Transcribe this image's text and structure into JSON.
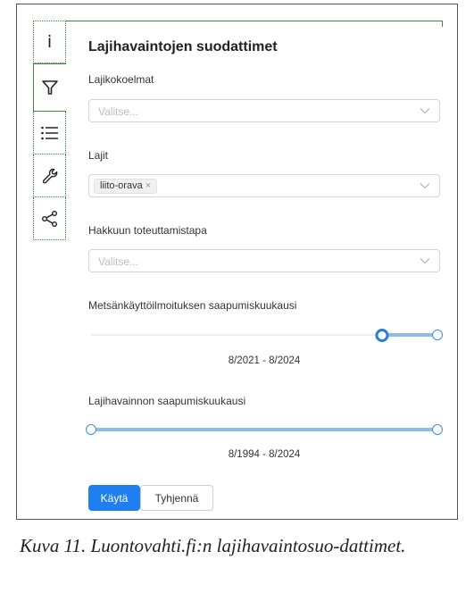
{
  "toolbar": {
    "items": [
      {
        "icon": "info-icon",
        "glyph": "i"
      },
      {
        "icon": "filter-icon",
        "active": true
      },
      {
        "icon": "list-icon"
      },
      {
        "icon": "wrench-icon"
      },
      {
        "icon": "share-icon"
      }
    ],
    "accent_color": "#3a8a3a"
  },
  "panel": {
    "title": "Lajihavaintojen suodattimet",
    "filters": {
      "species_collections": {
        "label": "Lajikokoelmat",
        "placeholder": "Valitse..."
      },
      "species": {
        "label": "Lajit",
        "selected_tags": [
          "liito-orava"
        ],
        "tag_remove": "×"
      },
      "harvest_method": {
        "label": "Hakkuun toteuttamistapa",
        "placeholder": "Valitse..."
      }
    },
    "forest_notice_month": {
      "label": "Metsänkäyttöilmoituksen saapumiskuukausi",
      "range_text": "8/2021 - 8/2024",
      "handle_start": 0.84,
      "handle_end": 1.0
    },
    "observation_month": {
      "label": "Lajihavainnon saapumiskuukausi",
      "range_text": "8/1994 - 8/2024",
      "handle_start": 0.0,
      "handle_end": 1.0
    },
    "buttons": {
      "apply": "Käytä",
      "clear": "Tyhjennä"
    },
    "primary_color": "#1f7ff0"
  },
  "caption": "Kuva 11. Luontovahti.fi:n lajihavaintosuo-dattimet."
}
